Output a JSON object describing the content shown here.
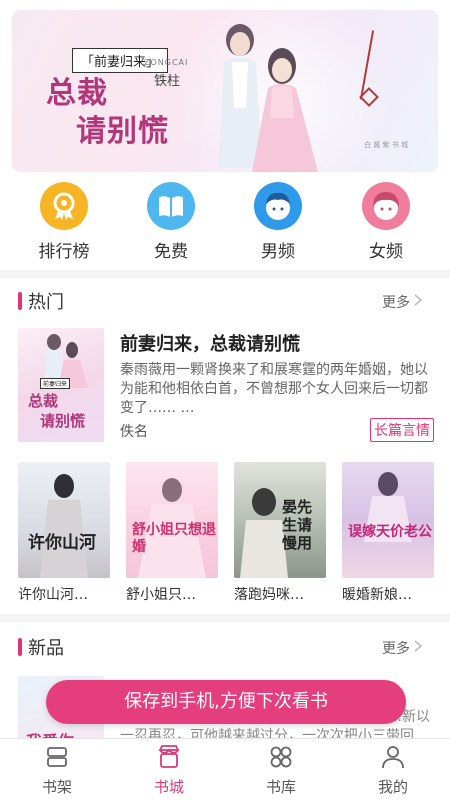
{
  "banner": {
    "badge": "「前妻归来」",
    "title_line1": "总裁",
    "title_line2": "请别慌",
    "subtitle": "铁柱",
    "roman": "ZONGCAI",
    "publisher": "白 酱 紫 书 城"
  },
  "categories": [
    {
      "label": "排行榜",
      "icon": "ranking-icon"
    },
    {
      "label": "免费",
      "icon": "book-icon"
    },
    {
      "label": "男频",
      "icon": "boy-face-icon"
    },
    {
      "label": "女频",
      "icon": "girl-face-icon"
    }
  ],
  "hot": {
    "title": "热门",
    "more": "更多",
    "featured": {
      "cover_tag": "前妻归来",
      "cover_title1": "总裁",
      "cover_title2": "请别慌",
      "title": "前妻归来，总裁请别慌",
      "desc": "秦雨薇用一颗肾换来了和展寒霆的两年婚姻，她以为能和他相依白首，不曾想那个女人回来后一切都变了…… …",
      "author": "佚名",
      "tag": "长篇言情"
    },
    "books": [
      {
        "name": "许你山河…",
        "cover_text": "许你山河"
      },
      {
        "name": "舒小姐只…",
        "cover_text": "舒小姐只想退婚"
      },
      {
        "name": "落跑妈咪…",
        "cover_text": "晏先生请慢用"
      },
      {
        "name": "暖婚新娘…",
        "cover_text": "误嫁天价老公"
      }
    ]
  },
  "new_section": {
    "title": "新品",
    "more": "更多",
    "cover_text": "我爱你",
    "desc_line1": "…新以",
    "desc_line2": "一忍再忍，可他越来越过分，一次次把小三带回"
  },
  "toast": "保存到手机,方便下次看书",
  "tabs": [
    {
      "label": "书架",
      "icon": "bookshelf-icon"
    },
    {
      "label": "书城",
      "icon": "bookstore-icon"
    },
    {
      "label": "书库",
      "icon": "library-icon"
    },
    {
      "label": "我的",
      "icon": "profile-icon"
    }
  ],
  "colors": {
    "accent": "#e53e7d",
    "active_tab": "#d63b7a"
  }
}
